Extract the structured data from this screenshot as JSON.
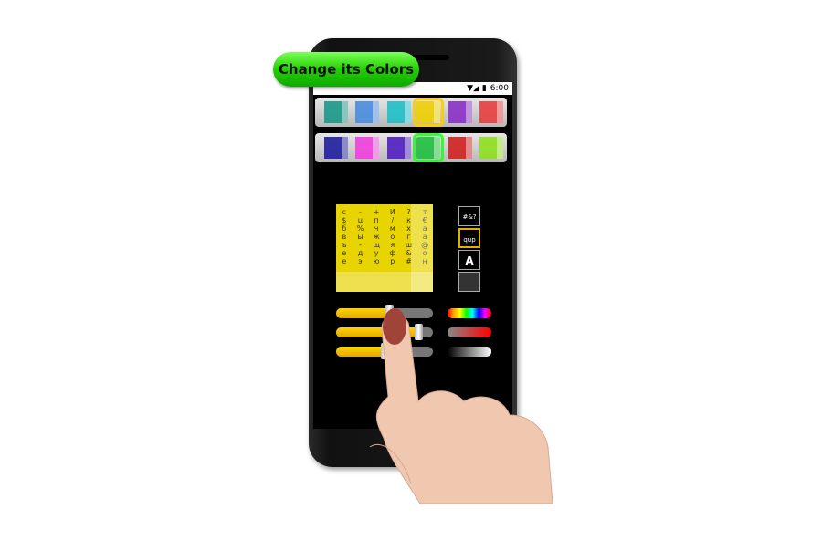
{
  "banner": {
    "label": "Change its Colors",
    "color": "#22d000"
  },
  "status": {
    "time": "6:00",
    "icons": [
      "wifi-icon",
      "signal-icon",
      "battery-icon"
    ]
  },
  "themes": {
    "row1": [
      {
        "color": "#1a9a8a"
      },
      {
        "color": "#4a8de0"
      },
      {
        "color": "#20c0c8"
      },
      {
        "color": "#f0d000",
        "selected": true
      },
      {
        "color": "#8a30c8"
      },
      {
        "color": "#e84040"
      }
    ],
    "row2": [
      {
        "color": "#2020a0"
      },
      {
        "color": "#f040e0"
      },
      {
        "color": "#5020c0"
      },
      {
        "color": "#20c040",
        "selected": true
      },
      {
        "color": "#d02020"
      },
      {
        "color": "#90e020"
      }
    ]
  },
  "keyboard_preview": {
    "keys": [
      "с",
      "-",
      "+",
      "И",
      "?",
      "т",
      "$",
      "ц",
      "п",
      "/",
      "к",
      "€",
      "б",
      "%",
      "ч",
      "м",
      "х",
      "а",
      "в",
      "ы",
      "ж",
      "о",
      "г",
      "а",
      "ъ",
      "-",
      "щ",
      "я",
      "ш",
      "@",
      "е",
      "д",
      "у",
      "ф",
      "&",
      "о",
      "е",
      "э",
      "ю",
      "р",
      "#",
      "н"
    ]
  },
  "layout_options": [
    {
      "label": "#&?"
    },
    {
      "label": "qup"
    },
    {
      "label": "A"
    },
    {
      "label": ""
    }
  ],
  "sliders": [
    {
      "value": 0.55
    },
    {
      "value": 0.85
    },
    {
      "value": 0.5
    }
  ],
  "color_bars": [
    "rainbow",
    "red-gradient",
    "black-white-gradient"
  ]
}
